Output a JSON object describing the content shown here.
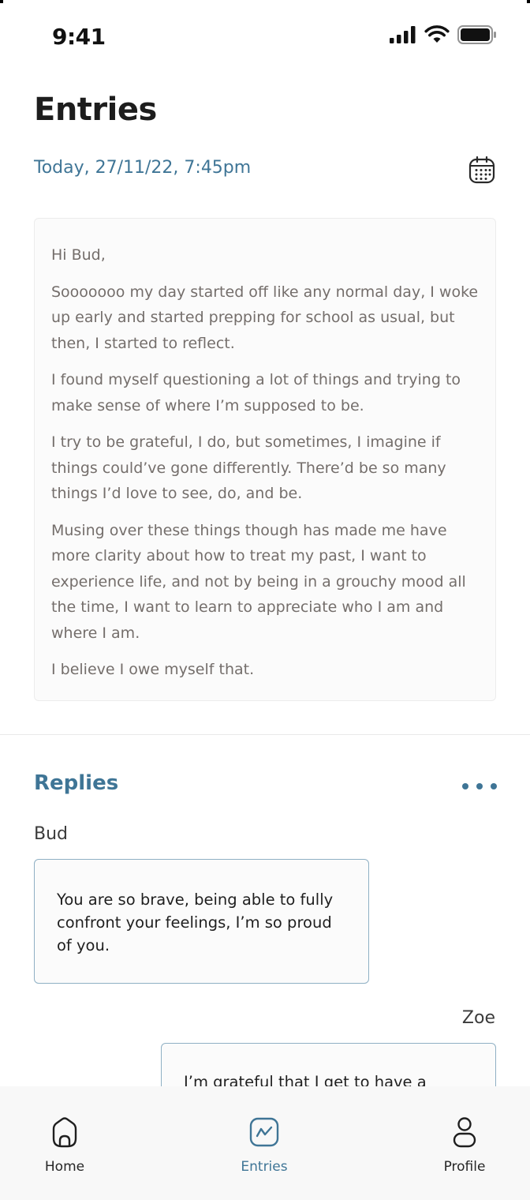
{
  "status_bar": {
    "time": "9:41"
  },
  "header": {
    "title": "Entries",
    "date_label": "Today, 27/11/22, 7:45pm",
    "calendar_icon": "calendar-icon"
  },
  "entry": {
    "paragraphs": [
      "Hi Bud,",
      "Sooooooo my day started off like any normal day, I woke up early and started prepping for school as usual, but then, I started to reflect.",
      "I found myself questioning a lot of things and trying to make sense of where I’m supposed to be.",
      "I try to be grateful, I do, but sometimes, I imagine if things could’ve gone differently. There’d be so many things I’d love to see, do, and be.",
      "Musing over these things though has made me have more clarity about how to treat my past, I want to experience life, and not by being in a grouchy mood all the time, I want to learn to appreciate who I am and where I am.",
      "I believe I owe myself that."
    ]
  },
  "replies": {
    "title": "Replies",
    "more_icon": "more-horizontal-icon",
    "items": [
      {
        "author": "Bud",
        "text": "You are so brave, being able to fully confront your feelings, I’m so proud of you."
      },
      {
        "author": "Zoe",
        "text": "I’m grateful that I get to have a"
      }
    ]
  },
  "nav": {
    "items": [
      {
        "label": "Home",
        "icon": "home-icon"
      },
      {
        "label": "Entries",
        "icon": "entries-chart-icon",
        "active": true
      },
      {
        "label": "Profile",
        "icon": "profile-icon"
      }
    ]
  },
  "colors": {
    "accent": "#3f7596",
    "body_text": "#746e6b",
    "bubble_border": "#8fb0c4",
    "nav_background": "#f8f8f8"
  }
}
